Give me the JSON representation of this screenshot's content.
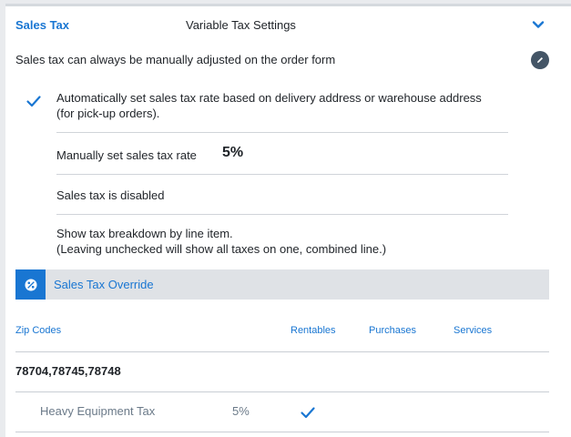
{
  "header": {
    "title": "Sales Tax",
    "subtitle": "Variable Tax Settings"
  },
  "manual_note": "Sales tax can always be manually adjusted on the order form",
  "options": {
    "auto_line1": "Automatically set sales tax rate based on delivery address or warehouse address",
    "auto_line2": "(for pick-up orders).",
    "auto_checked": true,
    "manual_label": "Manually set sales tax rate",
    "manual_rate": "5%",
    "disabled_label": "Sales tax is disabled",
    "breakdown_line1": "Show tax breakdown by line item.",
    "breakdown_line2": "(Leaving unchecked will show all taxes on one, combined line.)"
  },
  "override": {
    "label": "Sales Tax Override"
  },
  "table": {
    "columns": {
      "zip": "Zip Codes",
      "rentables": "Rentables",
      "purchases": "Purchases",
      "services": "Services"
    },
    "zip_values": "78704,78745,78748",
    "rows": [
      {
        "name": "Heavy Equipment Tax",
        "rate": "5%",
        "rentables": true,
        "purchases": false,
        "services": false
      }
    ]
  },
  "colors": {
    "accent": "#1976d2",
    "text": "#1f2328",
    "muted": "#6b7a89",
    "bar": "#dfe2e6",
    "edit_button": "#445566"
  }
}
